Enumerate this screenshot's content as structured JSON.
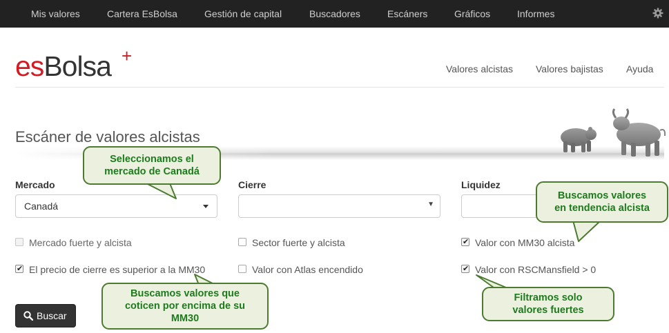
{
  "topnav": {
    "items": [
      "Mis valores",
      "Cartera EsBolsa",
      "Gestión de capital",
      "Buscadores",
      "Escáners",
      "Gráficos",
      "Informes"
    ],
    "settings_icon": "gear-icon"
  },
  "header": {
    "logo": {
      "part1": "es",
      "part2": "Bolsa",
      "sup": "+"
    },
    "nav": [
      "Valores alcistas",
      "Valores bajistas",
      "Ayuda"
    ]
  },
  "page": {
    "title": "Escáner de valores alcistas",
    "banner_icon": "bull-bear-icon"
  },
  "form": {
    "mercado": {
      "label": "Mercado",
      "value": "Canadá"
    },
    "cierre": {
      "label": "Cierre",
      "value": ""
    },
    "liquidez": {
      "label": "Liquidez",
      "value": ""
    },
    "checkboxes": {
      "mercado_fuerte": {
        "label": "Mercado fuerte y alcista",
        "checked": false
      },
      "precio_mm30": {
        "label": "El precio de cierre es superior a la MM30",
        "checked": true
      },
      "sector_fuerte": {
        "label": "Sector fuerte y alcista",
        "checked": false
      },
      "atlas": {
        "label": "Valor con Atlas encendido",
        "checked": false
      },
      "mm30_alcista": {
        "label": "Valor con MM30 alcista",
        "checked": true
      },
      "rsc": {
        "label": "Valor con RSCMansfield > 0",
        "checked": true
      }
    },
    "search_button": "Buscar"
  },
  "callouts": {
    "mercado": [
      "Seleccionamos el",
      "mercado de Canadá"
    ],
    "tendencia": [
      "Buscamos valores",
      "en tendencia alcista"
    ],
    "mm30": [
      "Buscamos valores que",
      "coticen por encima de su",
      "MM30"
    ],
    "fuertes": [
      "Filtramos solo",
      "valores fuertes"
    ]
  },
  "colors": {
    "navbar": "#222222",
    "logo_red": "#d21b23",
    "callout_bg": "#ebf1de",
    "callout_border": "#4c7a30",
    "callout_text": "#1d7b1d",
    "button": "#333333"
  }
}
